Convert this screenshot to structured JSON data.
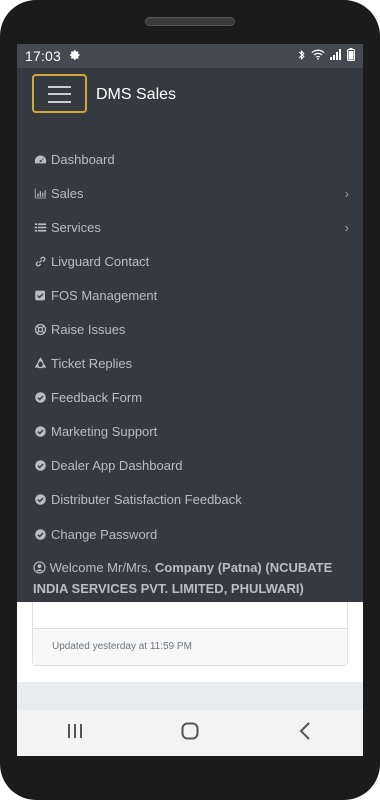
{
  "status_bar": {
    "time": "17:03",
    "settings_icon": "gear-icon",
    "bluetooth_icon": "bluetooth-icon",
    "wifi_icon": "wifi-icon",
    "signal_icon": "signal-icon",
    "battery_icon": "battery-icon"
  },
  "header": {
    "brand": "DMS Sales",
    "menu_icon": "hamburger-icon",
    "accent_color": "#d4a73a"
  },
  "menu": {
    "items": [
      {
        "label": "Dashboard",
        "icon": "dashboard-icon"
      },
      {
        "label": "Sales",
        "icon": "bar-chart-icon",
        "chevron": "›"
      },
      {
        "label": "Services",
        "icon": "list-icon",
        "chevron": "›"
      },
      {
        "label": "Livguard Contact",
        "icon": "link-icon"
      },
      {
        "label": "FOS Management",
        "icon": "check-square-icon"
      },
      {
        "label": "Raise Issues",
        "icon": "life-ring-icon"
      },
      {
        "label": "Ticket Replies",
        "icon": "recycle-icon"
      },
      {
        "label": "Feedback Form",
        "icon": "check-circle-icon"
      },
      {
        "label": "Marketing Support",
        "icon": "check-circle-icon"
      },
      {
        "label": "Dealer App Dashboard",
        "icon": "check-circle-icon"
      },
      {
        "label": "Distributer Satisfaction Feedback",
        "icon": "check-circle-icon"
      },
      {
        "label": "Change Password",
        "icon": "check-circle-icon"
      }
    ]
  },
  "welcome": {
    "prefix": "Welcome Mr/Mrs.",
    "name": "Company (Patna) (NCUBATE INDIA SERVICES PVT. LIMITED, PHULWARI)",
    "icon": "user-circle-icon"
  },
  "card": {
    "footer": "Updated yesterday at 11:59 PM"
  },
  "nav": {
    "recents_icon": "recents-icon",
    "home_icon": "home-icon",
    "back_icon": "back-icon"
  }
}
